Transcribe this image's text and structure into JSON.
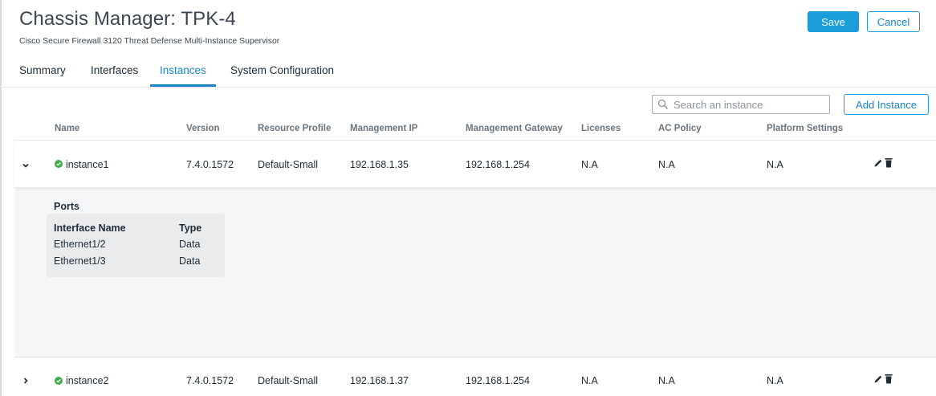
{
  "header": {
    "title": "Chassis Manager: TPK-4",
    "subtitle": "Cisco Secure Firewall 3120 Threat Defense Multi-Instance Supervisor",
    "save_label": "Save",
    "cancel_label": "Cancel"
  },
  "tabs": [
    {
      "label": "Summary",
      "active": false
    },
    {
      "label": "Interfaces",
      "active": false
    },
    {
      "label": "Instances",
      "active": true
    },
    {
      "label": "System Configuration",
      "active": false
    }
  ],
  "toolbar": {
    "search_placeholder": "Search an instance",
    "add_label": "Add Instance"
  },
  "table": {
    "columns": [
      "Name",
      "Version",
      "Resource Profile",
      "Management IP",
      "Management Gateway",
      "Licenses",
      "AC Policy",
      "Platform Settings"
    ],
    "rows": [
      {
        "name": "instance1",
        "version": "7.4.0.1572",
        "profile": "Default-Small",
        "ip": "192.168.1.35",
        "gateway": "192.168.1.254",
        "licenses": "N.A",
        "ac_policy": "N.A",
        "platform": "N.A",
        "expanded": true,
        "status": "ok"
      },
      {
        "name": "instance2",
        "version": "7.4.0.1572",
        "profile": "Default-Small",
        "ip": "192.168.1.37",
        "gateway": "192.168.1.254",
        "licenses": "N.A",
        "ac_policy": "N.A",
        "platform": "N.A",
        "expanded": false,
        "status": "ok"
      }
    ]
  },
  "ports": {
    "title": "Ports",
    "headers": [
      "Interface Name",
      "Type"
    ],
    "rows": [
      [
        "Ethernet1/2",
        "Data"
      ],
      [
        "Ethernet1/3",
        "Data"
      ]
    ]
  },
  "colors": {
    "accent": "#1a84c7",
    "button": "#1a9dd9",
    "status_ok": "#3fae49"
  },
  "icons": [
    "search-icon",
    "chevron-down-icon",
    "chevron-right-icon",
    "status-ok-icon",
    "edit-icon",
    "delete-icon"
  ]
}
